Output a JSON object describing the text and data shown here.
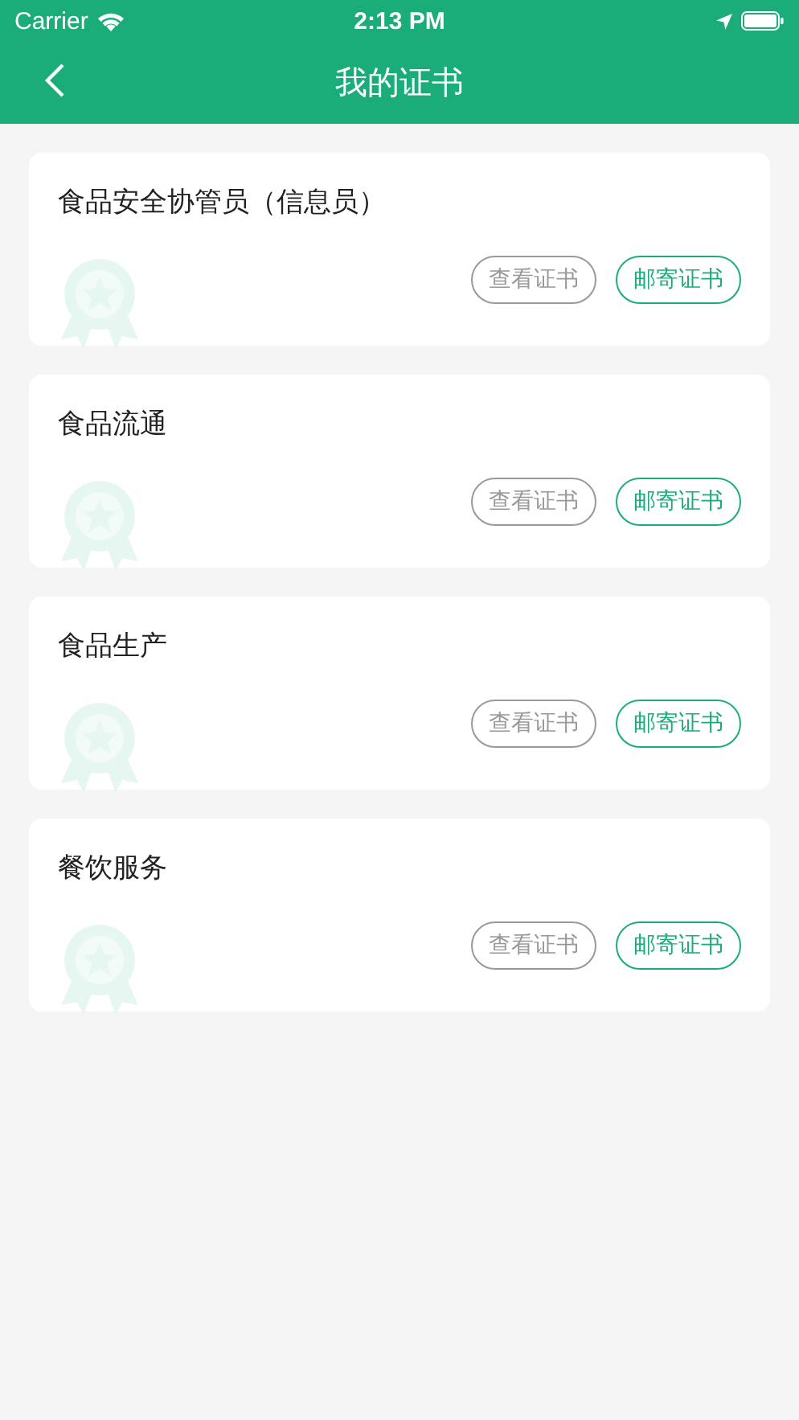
{
  "status_bar": {
    "carrier": "Carrier",
    "time": "2:13 PM"
  },
  "nav_bar": {
    "title": "我的证书"
  },
  "certificates": [
    {
      "title": "食品安全协管员（信息员）",
      "buttons": [
        {
          "label": "查看证书",
          "kind": "view"
        },
        {
          "label": "邮寄证书",
          "kind": "mail"
        }
      ]
    },
    {
      "title": "食品流通",
      "buttons": [
        {
          "label": "查看证书",
          "kind": "view"
        },
        {
          "label": "邮寄证书",
          "kind": "mail"
        }
      ]
    },
    {
      "title": "食品生产",
      "buttons": [
        {
          "label": "查看证书",
          "kind": "view"
        },
        {
          "label": "邮寄证书",
          "kind": "mail"
        }
      ]
    },
    {
      "title": "餐饮服务",
      "buttons": [
        {
          "label": "查看证书",
          "kind": "view"
        },
        {
          "label": "邮寄证书",
          "kind": "mail"
        }
      ]
    }
  ]
}
